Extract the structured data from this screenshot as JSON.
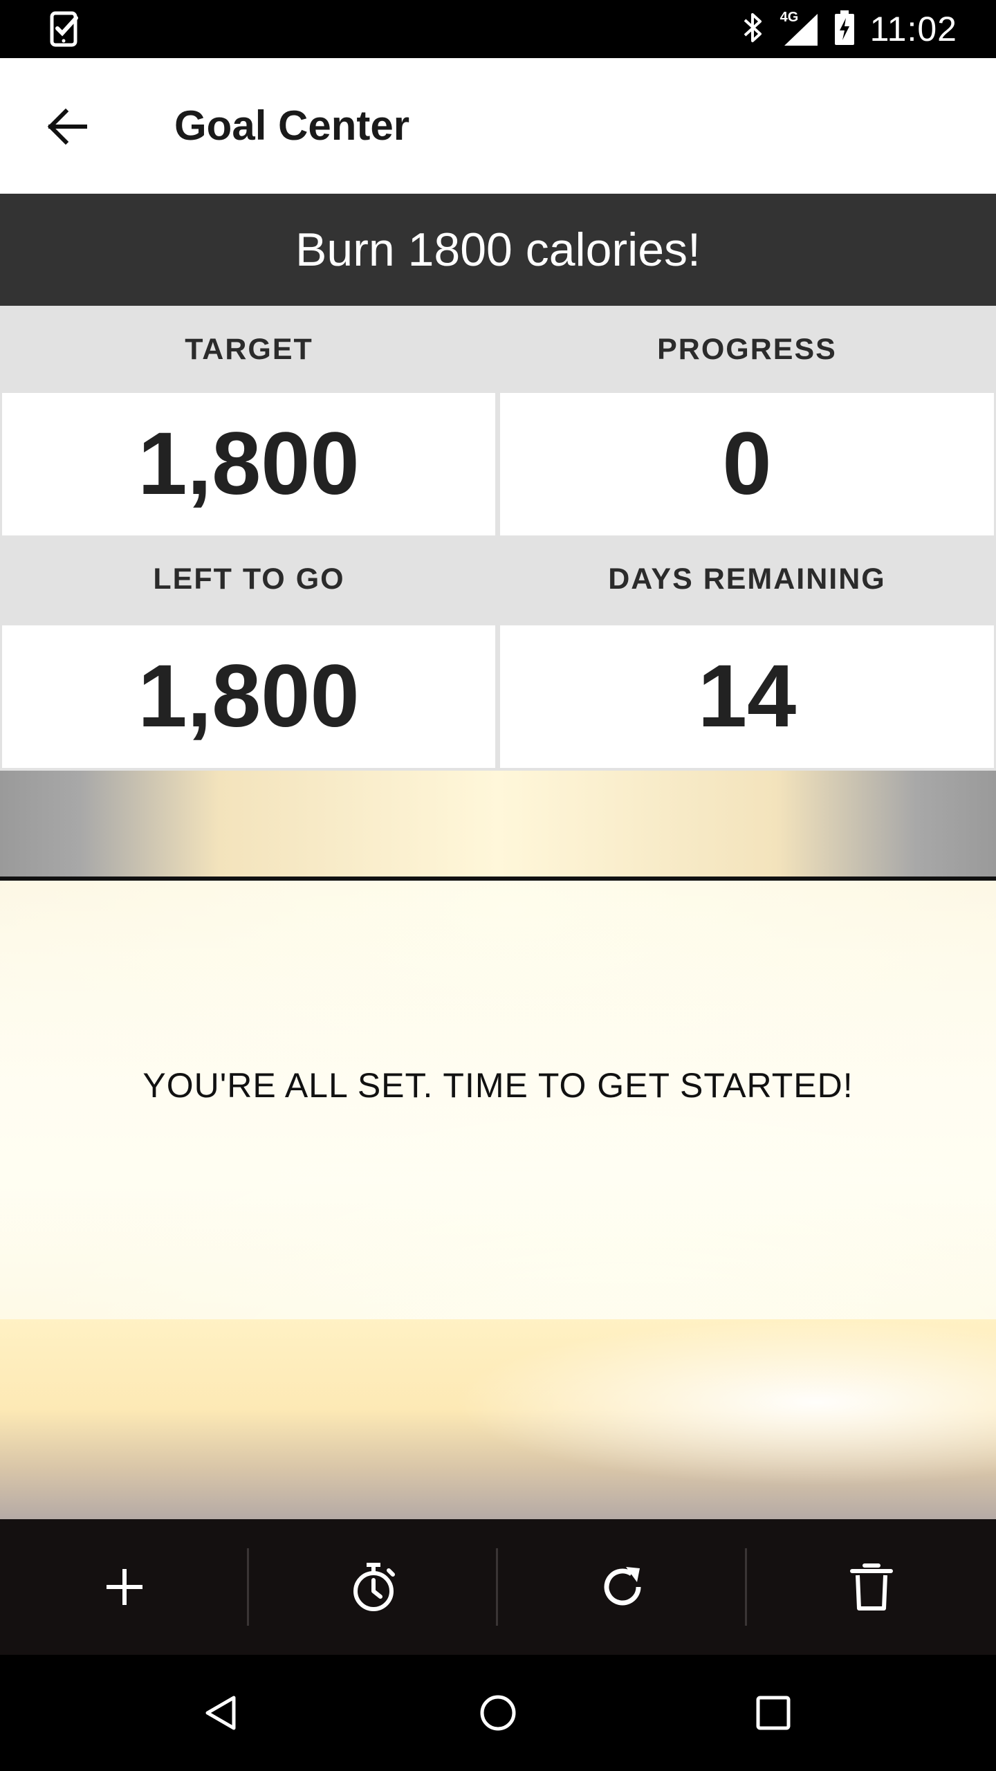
{
  "status_bar": {
    "time": "11:02",
    "network": "4G",
    "icons": [
      "task-check-icon",
      "bluetooth-icon",
      "signal-icon",
      "battery-charging-icon"
    ]
  },
  "app_bar": {
    "title": "Goal Center",
    "back_icon": "arrow-left-icon"
  },
  "goal": {
    "title": "Burn 1800 calories!"
  },
  "stats": {
    "target_label": "TARGET",
    "target_value": "1,800",
    "progress_label": "PROGRESS",
    "progress_value": "0",
    "left_label": "LEFT TO GO",
    "left_value": "1,800",
    "days_label": "DAYS REMAINING",
    "days_value": "14"
  },
  "message": "YOU'RE ALL SET. TIME TO GET STARTED!",
  "toolbar": {
    "items": [
      "plus-icon",
      "stopwatch-icon",
      "refresh-icon",
      "trash-icon"
    ]
  },
  "nav_bar": {
    "items": [
      "back-triangle-icon",
      "home-circle-icon",
      "recents-square-icon"
    ]
  },
  "colors": {
    "header_bg": "#333333",
    "stats_bg": "#e2e2e2",
    "toolbar_bg": "#141010"
  }
}
